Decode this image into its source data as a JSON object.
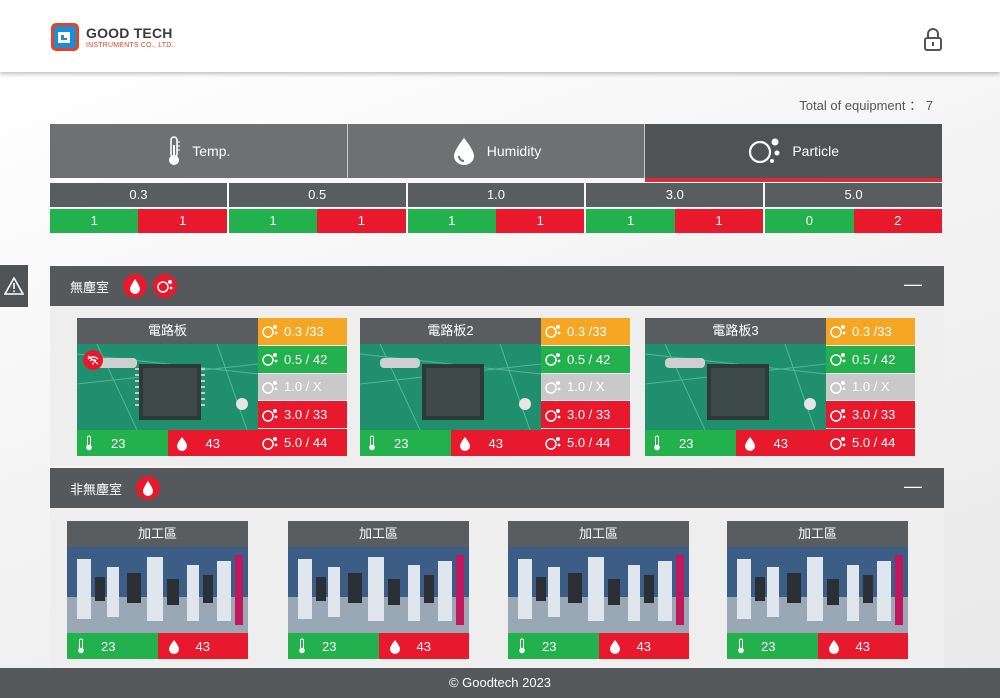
{
  "header": {
    "logo_main": "GOOD TECH",
    "logo_sub": "INSTRUMENTS CO., LTD."
  },
  "summary": {
    "total_label": "Total of equipment",
    "total_sep": "：",
    "total_value": "7"
  },
  "tabs": [
    {
      "label": "Temp.",
      "icon": "thermometer-icon"
    },
    {
      "label": "Humidity",
      "icon": "water-drop-icon"
    },
    {
      "label": "Particle",
      "icon": "particle-icon",
      "active": true
    }
  ],
  "particle_sizes": [
    {
      "size": "0.3",
      "ok": "1",
      "alarm": "1"
    },
    {
      "size": "0.5",
      "ok": "1",
      "alarm": "1"
    },
    {
      "size": "1.0",
      "ok": "1",
      "alarm": "1"
    },
    {
      "size": "3.0",
      "ok": "1",
      "alarm": "1"
    },
    {
      "size": "5.0",
      "ok": "0",
      "alarm": "2"
    }
  ],
  "sections": {
    "cleanroom": {
      "title": "無塵室",
      "collapse": "—",
      "devices": [
        {
          "name": "電路板",
          "temp": "23",
          "humidity": "43",
          "particles": [
            "0.3 /33",
            "0.5 / 42",
            "1.0 / X",
            "3.0 / 33",
            "5.0 / 44"
          ]
        },
        {
          "name": "電路板2",
          "temp": "23",
          "humidity": "43",
          "particles": [
            "0.3 /33",
            "0.5 / 42",
            "1.0 / X",
            "3.0 / 33",
            "5.0 / 44"
          ]
        },
        {
          "name": "電路板3",
          "temp": "23",
          "humidity": "43",
          "particles": [
            "0.3 /33",
            "0.5 / 42",
            "1.0 / X",
            "3.0 / 33",
            "5.0 / 44"
          ]
        }
      ]
    },
    "non_cleanroom": {
      "title": "非無塵室",
      "collapse": "—",
      "devices": [
        {
          "name": "加工區",
          "temp": "23",
          "humidity": "43"
        },
        {
          "name": "加工區",
          "temp": "23",
          "humidity": "43"
        },
        {
          "name": "加工區",
          "temp": "23",
          "humidity": "43"
        },
        {
          "name": "加工區",
          "temp": "23",
          "humidity": "43"
        }
      ]
    }
  },
  "footer": {
    "text": "© Goodtech 2023"
  },
  "colors": {
    "ok": "#22b14c",
    "alarm": "#e8192c",
    "warn": "#f5a623",
    "offline": "#c9c9c9",
    "bar": "#55595c"
  }
}
